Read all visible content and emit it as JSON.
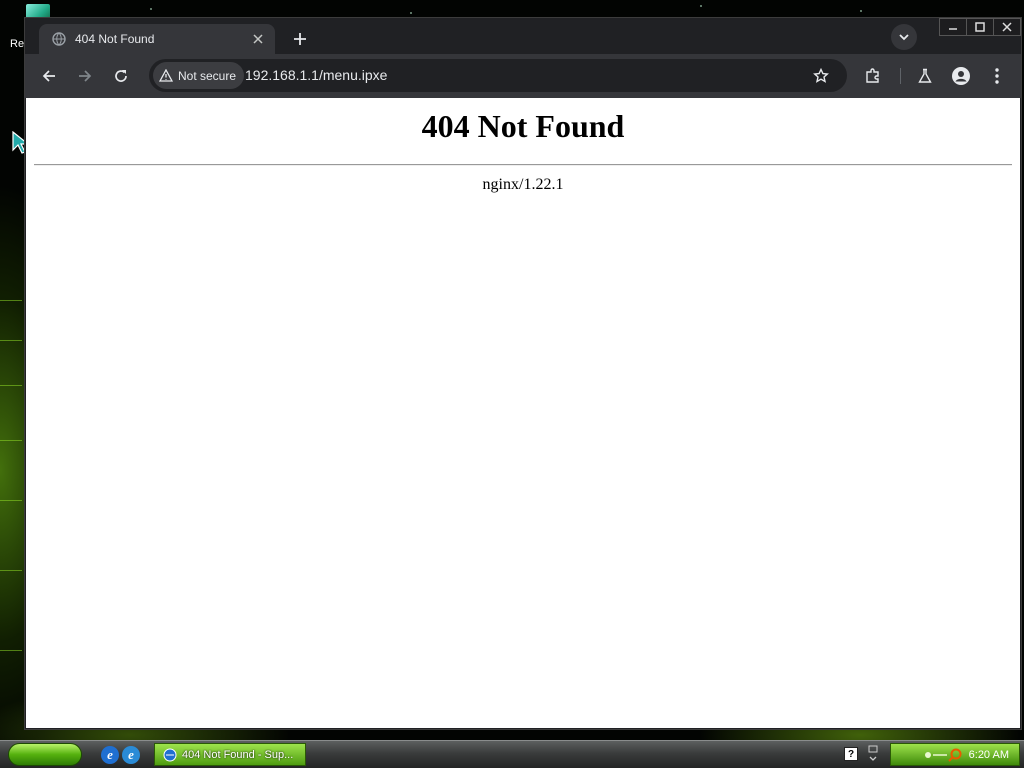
{
  "desktop": {
    "icon_label": "Re"
  },
  "browser": {
    "tab": {
      "title": "404 Not Found",
      "favicon": "globe-icon"
    },
    "address_bar": {
      "security_label": "Not secure",
      "url": "192.168.1.1/menu.ipxe"
    }
  },
  "page": {
    "heading": "404 Not Found",
    "server": "nginx/1.22.1"
  },
  "taskbar": {
    "task_label": "404 Not Found - Sup...",
    "help_label": "?",
    "clock": "6:20 AM"
  },
  "colors": {
    "chrome_frame": "#202124",
    "chrome_toolbar": "#35363a",
    "taskbar_green": "#4e9c10"
  }
}
